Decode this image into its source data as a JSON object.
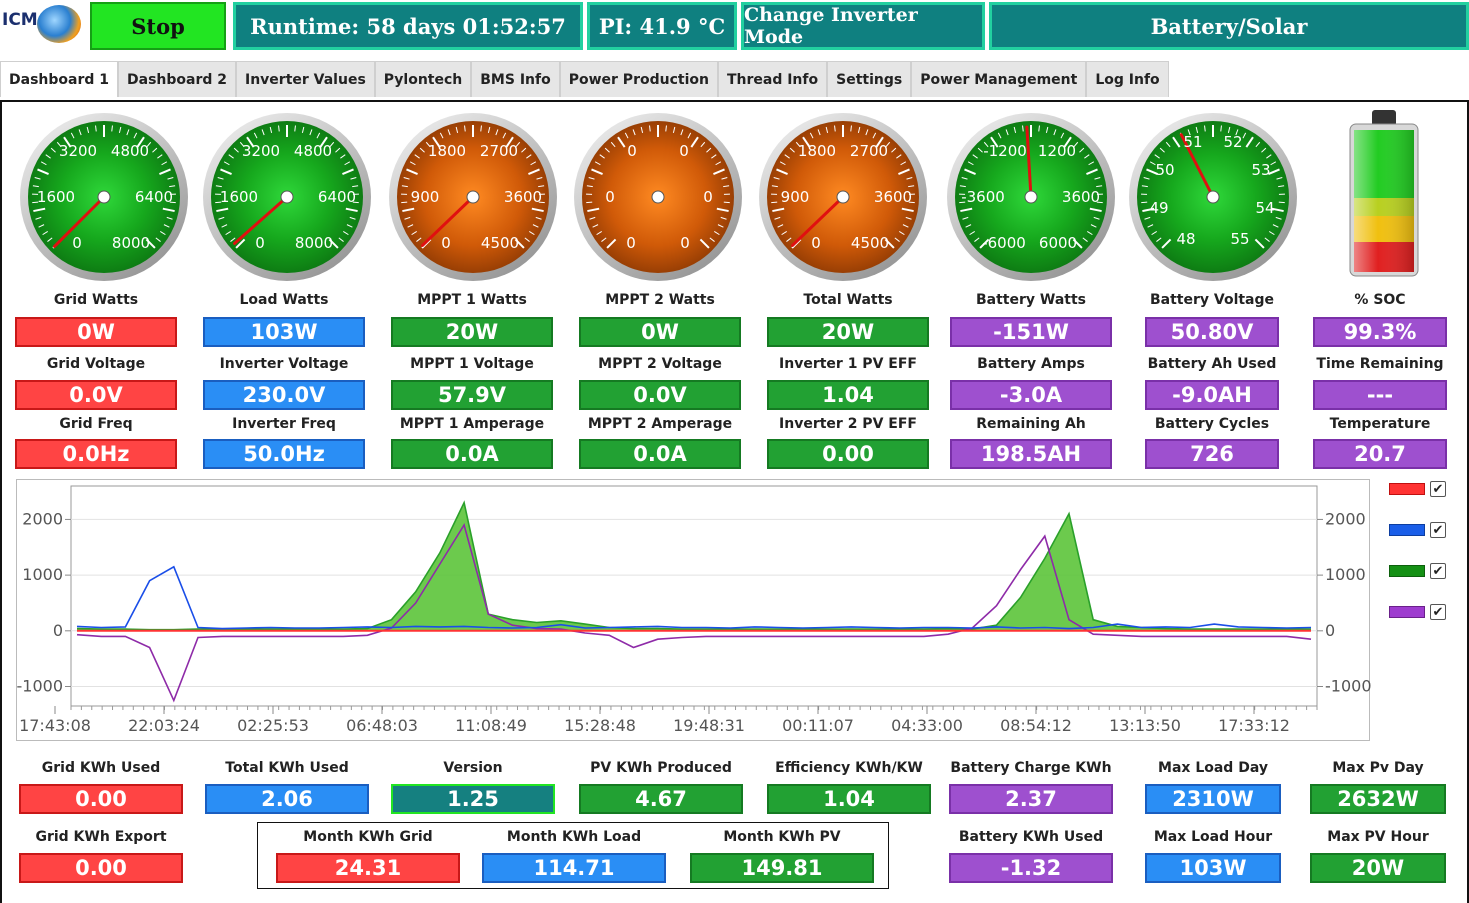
{
  "header": {
    "logo_text": "ICM",
    "stop_label": "Stop",
    "runtime": "Runtime: 58 days 01:52:57",
    "pi_temp": "PI: 41.9 °C",
    "change_mode": "Change Inverter Mode",
    "mode": "Battery/Solar"
  },
  "tabs": [
    "Dashboard 1",
    "Dashboard 2",
    "Inverter Values",
    "Pylontech",
    "BMS Info",
    "Power Production",
    "Thread Info",
    "Settings",
    "Power Management",
    "Log Info"
  ],
  "gauges": [
    {
      "name": "grid-watts-gauge",
      "face": "green",
      "labels": [
        "3200",
        "4800",
        "1600",
        "6400",
        "0",
        "8000"
      ],
      "needle_value": 0,
      "min": 0,
      "max": 8000
    },
    {
      "name": "load-watts-gauge",
      "face": "green",
      "labels": [
        "3200",
        "4800",
        "1600",
        "6400",
        "0",
        "8000"
      ],
      "needle_value": 103,
      "min": 0,
      "max": 8000
    },
    {
      "name": "mppt1-watts-gauge",
      "face": "orange",
      "labels": [
        "1800",
        "2700",
        "900",
        "3600",
        "0",
        "4500"
      ],
      "needle_value": 20,
      "min": 0,
      "max": 4500
    },
    {
      "name": "mppt2-watts-gauge",
      "face": "orange",
      "labels": [
        "0",
        "0",
        "0",
        "0",
        "0",
        "0"
      ],
      "needle_value": 0,
      "min": 0,
      "max": 0
    },
    {
      "name": "total-watts-gauge",
      "face": "orange",
      "labels": [
        "1800",
        "2700",
        "900",
        "3600",
        "0",
        "4500"
      ],
      "needle_value": 20,
      "min": 0,
      "max": 4500
    },
    {
      "name": "battery-watts-gauge",
      "face": "green",
      "labels": [
        "-1200",
        "1200",
        "-3600",
        "3600",
        "-6000",
        "6000"
      ],
      "needle_value": -151,
      "min": -6000,
      "max": 6000
    },
    {
      "name": "battery-voltage-gauge",
      "face": "green",
      "labels": [
        "51",
        "52",
        "50",
        "53",
        "49",
        "54",
        "48",
        "55"
      ],
      "needle_value": 50.8,
      "min": 48,
      "max": 55
    }
  ],
  "rows": [
    {
      "labels": [
        "Grid Watts",
        "Load Watts",
        "MPPT 1 Watts",
        "MPPT 2 Watts",
        "Total Watts",
        "Battery Watts",
        "Battery Voltage",
        "% SOC"
      ],
      "values": [
        "0W",
        "103W",
        "20W",
        "0W",
        "20W",
        "-151W",
        "50.80V",
        "99.3%"
      ]
    },
    {
      "labels": [
        "Grid Voltage",
        "Inverter Voltage",
        "MPPT 1 Voltage",
        "MPPT 2 Voltage",
        "Inverter 1 PV EFF",
        "Battery Amps",
        "Battery Ah Used",
        "Time Remaining"
      ],
      "values": [
        "0.0V",
        "230.0V",
        "57.9V",
        "0.0V",
        "1.04",
        "-3.0A",
        "-9.0AH",
        "---"
      ]
    },
    {
      "labels": [
        "Grid Freq",
        "Inverter Freq",
        "MPPT 1 Amperage",
        "MPPT 2 Amperage",
        "Inverter 2 PV EFF",
        "Remaining Ah",
        "Battery Cycles",
        "Temperature"
      ],
      "values": [
        "0.0Hz",
        "50.0Hz",
        "0.0A",
        "0.0A",
        "0.00",
        "198.5AH",
        "726",
        "20.7"
      ]
    }
  ],
  "battery_soc": 99.3,
  "chart_data": {
    "type": "line",
    "x_ticks": [
      "17:43:08",
      "22:03:24",
      "02:25:53",
      "06:48:03",
      "11:08:49",
      "15:28:48",
      "19:48:31",
      "00:11:07",
      "04:33:00",
      "08:54:12",
      "13:13:50",
      "17:33:12"
    ],
    "y_ticks": [
      "2000",
      "1000",
      "0",
      "-1000"
    ],
    "ylim": [
      -1350,
      2600
    ],
    "series": [
      {
        "color": "#ff3333",
        "values": [
          0,
          0,
          0,
          0,
          0,
          0,
          0,
          0,
          0,
          0,
          0,
          0,
          0,
          0,
          0,
          0,
          0,
          0,
          0,
          0,
          0,
          0,
          0,
          0,
          0,
          0,
          0,
          0,
          0,
          0,
          0,
          0,
          0,
          0,
          0,
          0,
          0,
          0,
          0,
          0,
          0,
          0,
          0,
          0,
          0,
          0,
          0,
          0,
          0,
          0,
          0,
          0
        ]
      },
      {
        "color": "#1a4ee8",
        "values": [
          80,
          60,
          70,
          900,
          1150,
          60,
          40,
          50,
          60,
          50,
          50,
          60,
          70,
          60,
          80,
          70,
          80,
          60,
          50,
          60,
          110,
          50,
          60,
          70,
          80,
          60,
          60,
          50,
          70,
          60,
          50,
          60,
          70,
          60,
          50,
          60,
          60,
          50,
          70,
          50,
          60,
          40,
          60,
          120,
          60,
          70,
          60,
          120,
          70,
          60,
          50,
          60
        ]
      },
      {
        "color": "#2aa02a",
        "values": [
          40,
          30,
          30,
          20,
          20,
          30,
          30,
          30,
          30,
          30,
          30,
          30,
          40,
          200,
          700,
          1400,
          2300,
          300,
          200,
          150,
          180,
          120,
          60,
          40,
          40,
          30,
          30,
          30,
          30,
          30,
          30,
          30,
          30,
          30,
          30,
          30,
          40,
          30,
          100,
          600,
          1300,
          2100,
          200,
          80,
          60,
          40,
          30,
          30,
          30,
          30,
          30,
          30
        ]
      },
      {
        "color": "#8e2ba8",
        "values": [
          -70,
          -100,
          -100,
          -300,
          -1250,
          -120,
          -100,
          -100,
          -100,
          -100,
          -100,
          -100,
          -80,
          50,
          500,
          1200,
          1900,
          300,
          100,
          40,
          30,
          -40,
          -80,
          -300,
          -150,
          -120,
          -100,
          -100,
          -100,
          -100,
          -100,
          -100,
          -100,
          -100,
          -100,
          -100,
          -60,
          50,
          450,
          1100,
          1700,
          200,
          -60,
          -80,
          -100,
          -100,
          -100,
          -100,
          -100,
          -100,
          -100,
          -150
        ]
      }
    ]
  },
  "bottom": {
    "labels": [
      "Grid KWh Used",
      "Total KWh Used",
      "Version",
      "PV KWh Produced",
      "Efficiency KWh/KW",
      "Battery Charge KWh",
      "Max Load Day",
      "Max Pv Day"
    ],
    "values": [
      "0.00",
      "2.06",
      "1.25",
      "4.67",
      "1.04",
      "2.37",
      "2310W",
      "2632W"
    ],
    "grid_export_label": "Grid KWh Export",
    "grid_export_value": "0.00",
    "month_labels": [
      "Month KWh Grid",
      "Month KWh Load",
      "Month KWh PV"
    ],
    "month_values": [
      "24.31",
      "114.71",
      "149.81"
    ],
    "right_labels": [
      "Battery KWh Used",
      "Max Load Hour",
      "Max PV Hour"
    ],
    "right_values": [
      "-1.32",
      "103W",
      "20W"
    ]
  }
}
